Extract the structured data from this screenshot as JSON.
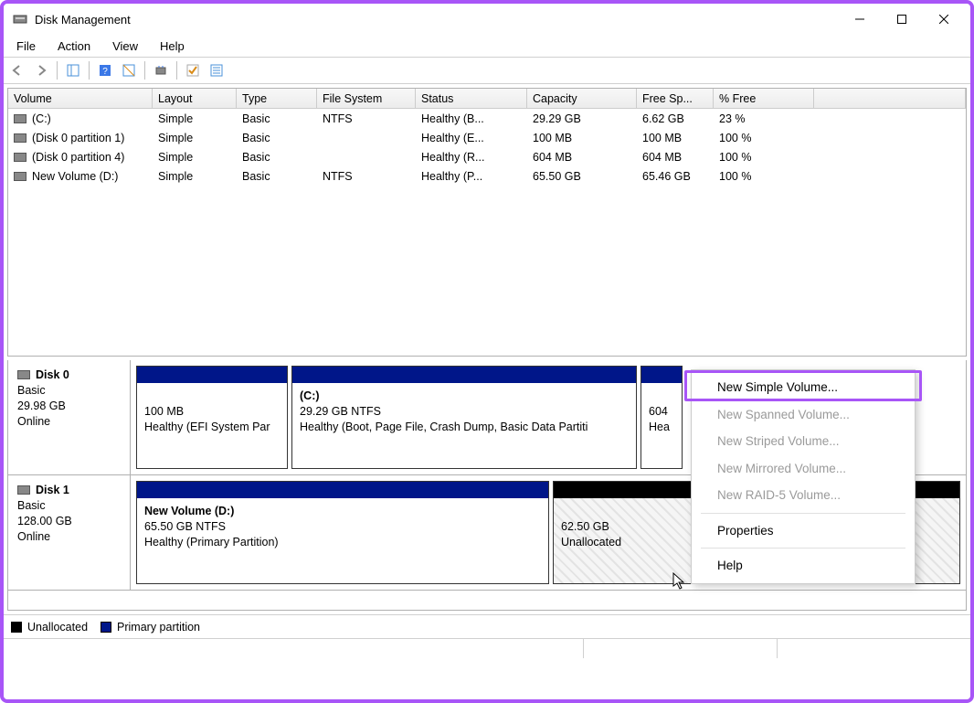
{
  "window": {
    "title": "Disk Management"
  },
  "menu": {
    "file": "File",
    "action": "Action",
    "view": "View",
    "help": "Help"
  },
  "columns": {
    "volume": "Volume",
    "layout": "Layout",
    "type": "Type",
    "fs": "File System",
    "status": "Status",
    "capacity": "Capacity",
    "free": "Free Sp...",
    "pct": "% Free"
  },
  "volumes": [
    {
      "name": "(C:)",
      "layout": "Simple",
      "type": "Basic",
      "fs": "NTFS",
      "status": "Healthy (B...",
      "capacity": "29.29 GB",
      "free": "6.62 GB",
      "pct": "23 %"
    },
    {
      "name": "(Disk 0 partition 1)",
      "layout": "Simple",
      "type": "Basic",
      "fs": "",
      "status": "Healthy (E...",
      "capacity": "100 MB",
      "free": "100 MB",
      "pct": "100 %"
    },
    {
      "name": "(Disk 0 partition 4)",
      "layout": "Simple",
      "type": "Basic",
      "fs": "",
      "status": "Healthy (R...",
      "capacity": "604 MB",
      "free": "604 MB",
      "pct": "100 %"
    },
    {
      "name": "New Volume (D:)",
      "layout": "Simple",
      "type": "Basic",
      "fs": "NTFS",
      "status": "Healthy (P...",
      "capacity": "65.50 GB",
      "free": "65.46 GB",
      "pct": "100 %"
    }
  ],
  "disks": {
    "d0": {
      "name": "Disk 0",
      "type": "Basic",
      "size": "29.98 GB",
      "status": "Online",
      "p0": {
        "title": "",
        "size": "100 MB",
        "status": "Healthy (EFI System Par"
      },
      "p1": {
        "title": "(C:)",
        "sizefs": "29.29 GB NTFS",
        "status": "Healthy (Boot, Page File, Crash Dump, Basic Data Partiti"
      },
      "p2": {
        "title": "",
        "size": "604",
        "status": "Hea"
      }
    },
    "d1": {
      "name": "Disk 1",
      "type": "Basic",
      "size": "128.00 GB",
      "status": "Online",
      "p0": {
        "title": "New Volume  (D:)",
        "sizefs": "65.50 GB NTFS",
        "status": "Healthy (Primary Partition)"
      },
      "p1": {
        "size": "62.50 GB",
        "status": "Unallocated"
      }
    }
  },
  "legend": {
    "unalloc": "Unallocated",
    "primary": "Primary partition"
  },
  "context": {
    "new_simple": "New Simple Volume...",
    "new_spanned": "New Spanned Volume...",
    "new_striped": "New Striped Volume...",
    "new_mirrored": "New Mirrored Volume...",
    "new_raid5": "New RAID-5 Volume...",
    "properties": "Properties",
    "help": "Help"
  }
}
